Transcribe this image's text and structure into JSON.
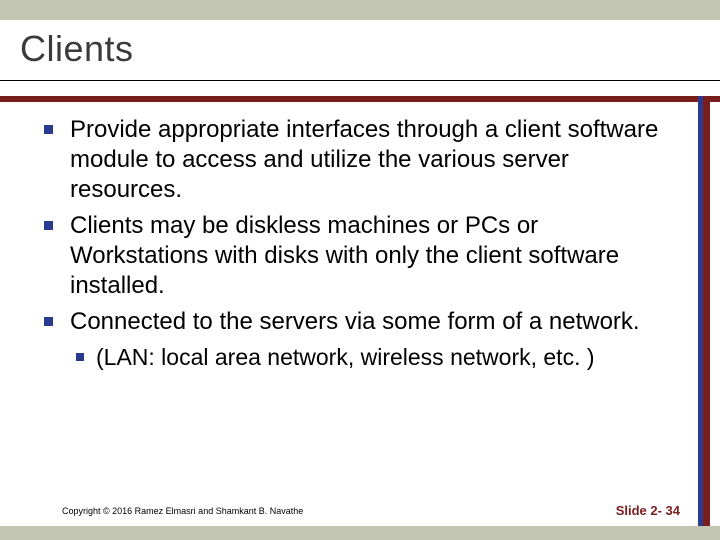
{
  "title": "Clients",
  "bullets": [
    {
      "text": "Provide appropriate interfaces through a client software module to access and utilize the various server resources."
    },
    {
      "text": "Clients may be diskless machines or PCs or Workstations with disks with only the client software installed."
    },
    {
      "text": "Connected to the servers via some form of a network.",
      "sub": [
        {
          "text": "(LAN: local area network, wireless network, etc. )"
        }
      ]
    }
  ],
  "copyright": "Copyright © 2016 Ramez Elmasri and Shamkant B. Navathe",
  "slidenum": "Slide 2- 34"
}
